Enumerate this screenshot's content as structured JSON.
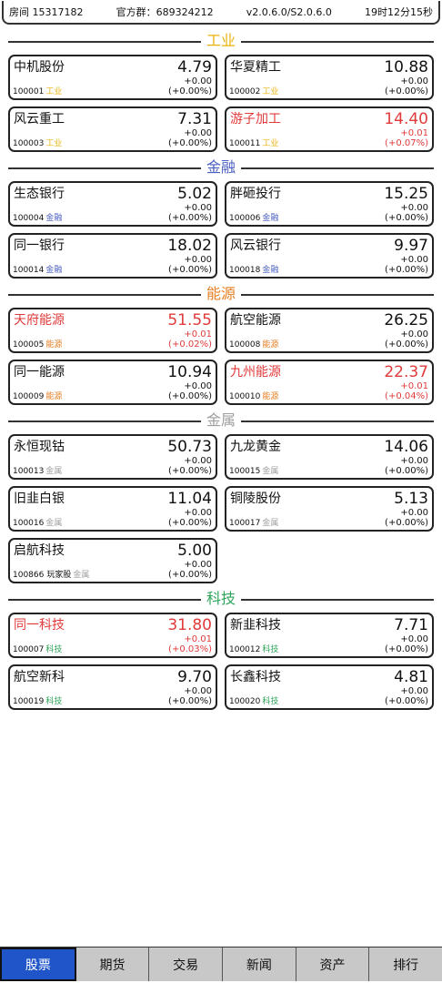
{
  "topbar": {
    "room": "房间 15317182",
    "group": "官方群：689324212",
    "version": "v2.0.6.0/S2.0.6.0",
    "time": "19时12分15秒"
  },
  "colors": {
    "up": "#e03a3a",
    "active_tab": "#1f55c9",
    "工业": "#e8b30c",
    "金融": "#4a5fc1",
    "能源": "#e67e22",
    "金属": "#9e9e9e",
    "科技": "#2ea55a"
  },
  "sectors": [
    {
      "name": "工业",
      "stocks": [
        {
          "name": "中机股份",
          "price": "4.79",
          "change": "+0.00",
          "pct": "(+0.00%)",
          "code": "100001",
          "tag": "",
          "sector": "工业",
          "up": false
        },
        {
          "name": "华夏精工",
          "price": "10.88",
          "change": "+0.00",
          "pct": "(+0.00%)",
          "code": "100002",
          "tag": "",
          "sector": "工业",
          "up": false
        },
        {
          "name": "风云重工",
          "price": "7.31",
          "change": "+0.00",
          "pct": "(+0.00%)",
          "code": "100003",
          "tag": "",
          "sector": "工业",
          "up": false
        },
        {
          "name": "游子加工",
          "price": "14.40",
          "change": "+0.01",
          "pct": "(+0.07%)",
          "code": "100011",
          "tag": "",
          "sector": "工业",
          "up": true
        }
      ]
    },
    {
      "name": "金融",
      "stocks": [
        {
          "name": "生态银行",
          "price": "5.02",
          "change": "+0.00",
          "pct": "(+0.00%)",
          "code": "100004",
          "tag": "",
          "sector": "金融",
          "up": false
        },
        {
          "name": "胖砸投行",
          "price": "15.25",
          "change": "+0.00",
          "pct": "(+0.00%)",
          "code": "100006",
          "tag": "",
          "sector": "金融",
          "up": false
        },
        {
          "name": "同一银行",
          "price": "18.02",
          "change": "+0.00",
          "pct": "(+0.00%)",
          "code": "100014",
          "tag": "",
          "sector": "金融",
          "up": false
        },
        {
          "name": "风云银行",
          "price": "9.97",
          "change": "+0.00",
          "pct": "(+0.00%)",
          "code": "100018",
          "tag": "",
          "sector": "金融",
          "up": false
        }
      ]
    },
    {
      "name": "能源",
      "stocks": [
        {
          "name": "天府能源",
          "price": "51.55",
          "change": "+0.01",
          "pct": "(+0.02%)",
          "code": "100005",
          "tag": "",
          "sector": "能源",
          "up": true
        },
        {
          "name": "航空能源",
          "price": "26.25",
          "change": "+0.00",
          "pct": "(+0.00%)",
          "code": "100008",
          "tag": "",
          "sector": "能源",
          "up": false
        },
        {
          "name": "同一能源",
          "price": "10.94",
          "change": "+0.00",
          "pct": "(+0.00%)",
          "code": "100009",
          "tag": "",
          "sector": "能源",
          "up": false
        },
        {
          "name": "九州能源",
          "price": "22.37",
          "change": "+0.01",
          "pct": "(+0.04%)",
          "code": "100010",
          "tag": "",
          "sector": "能源",
          "up": true
        }
      ]
    },
    {
      "name": "金属",
      "stocks": [
        {
          "name": "永恒现钴",
          "price": "50.73",
          "change": "+0.00",
          "pct": "(+0.00%)",
          "code": "100013",
          "tag": "",
          "sector": "金属",
          "up": false
        },
        {
          "name": "九龙黄金",
          "price": "14.06",
          "change": "+0.00",
          "pct": "(+0.00%)",
          "code": "100015",
          "tag": "",
          "sector": "金属",
          "up": false
        },
        {
          "name": "旧韭白银",
          "price": "11.04",
          "change": "+0.00",
          "pct": "(+0.00%)",
          "code": "100016",
          "tag": "",
          "sector": "金属",
          "up": false
        },
        {
          "name": "铜陵股份",
          "price": "5.13",
          "change": "+0.00",
          "pct": "(+0.00%)",
          "code": "100017",
          "tag": "",
          "sector": "金属",
          "up": false
        },
        {
          "name": "启航科技",
          "price": "5.00",
          "change": "+0.00",
          "pct": "(+0.00%)",
          "code": "100866",
          "tag": "玩家股",
          "sector": "金属",
          "up": false
        }
      ]
    },
    {
      "name": "科技",
      "stocks": [
        {
          "name": "同一科技",
          "price": "31.80",
          "change": "+0.01",
          "pct": "(+0.03%)",
          "code": "100007",
          "tag": "",
          "sector": "科技",
          "up": true
        },
        {
          "name": "新韭科技",
          "price": "7.71",
          "change": "+0.00",
          "pct": "(+0.00%)",
          "code": "100012",
          "tag": "",
          "sector": "科技",
          "up": false
        },
        {
          "name": "航空新科",
          "price": "9.70",
          "change": "+0.00",
          "pct": "(+0.00%)",
          "code": "100019",
          "tag": "",
          "sector": "科技",
          "up": false
        },
        {
          "name": "长鑫科技",
          "price": "4.81",
          "change": "+0.00",
          "pct": "(+0.00%)",
          "code": "100020",
          "tag": "",
          "sector": "科技",
          "up": false
        }
      ]
    }
  ],
  "tabs": [
    {
      "label": "股票",
      "active": true
    },
    {
      "label": "期货",
      "active": false
    },
    {
      "label": "交易",
      "active": false
    },
    {
      "label": "新闻",
      "active": false
    },
    {
      "label": "资产",
      "active": false
    },
    {
      "label": "排行",
      "active": false
    }
  ]
}
